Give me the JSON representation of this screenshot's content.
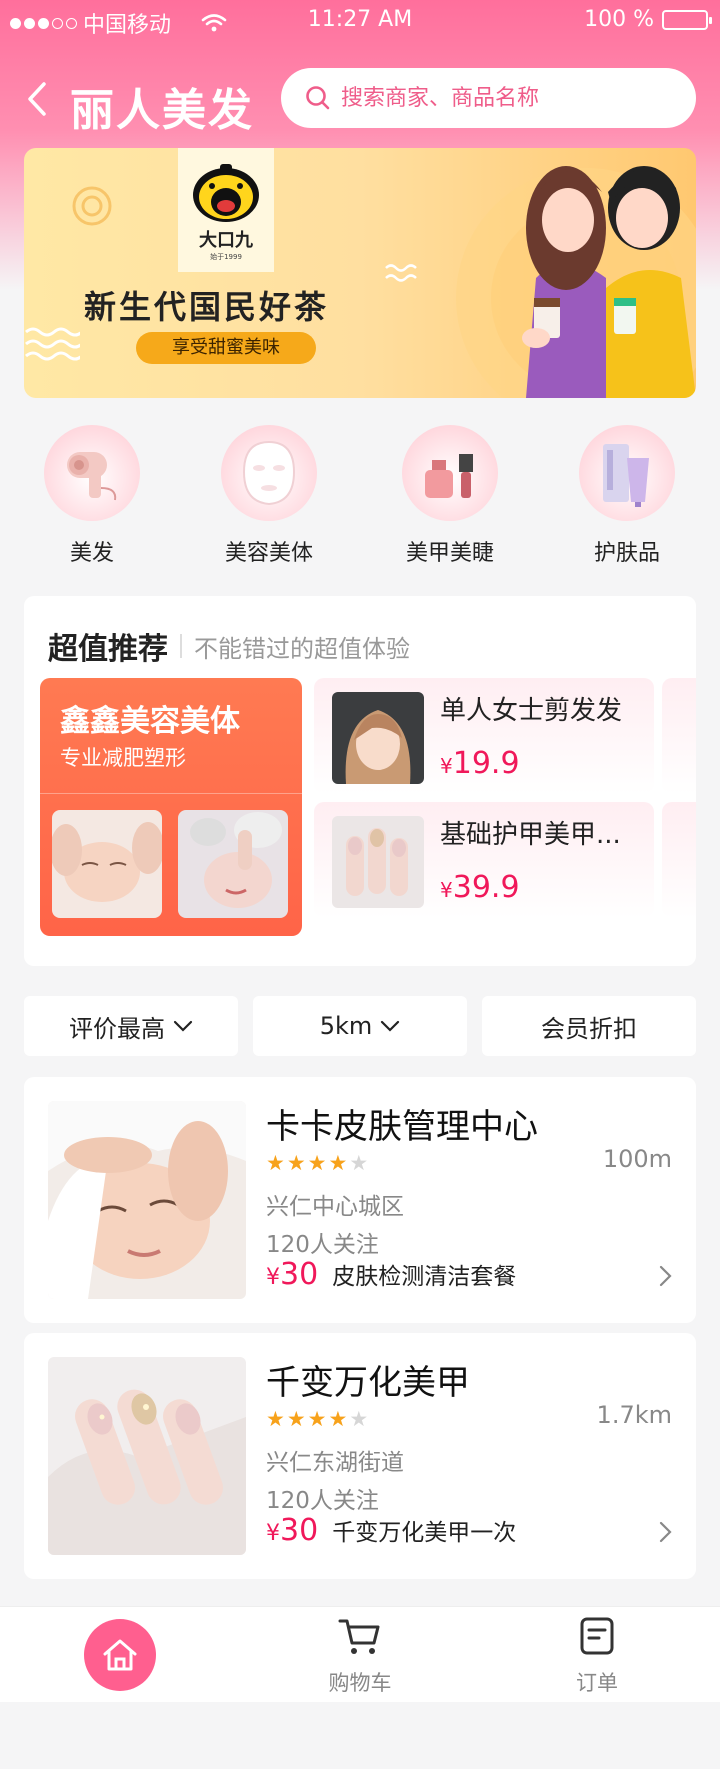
{
  "status_bar": {
    "carrier": "中国移动",
    "time": "11:27 AM",
    "battery": "100 %"
  },
  "header": {
    "title": "丽人美发",
    "search_placeholder": "搜索商家、商品名称"
  },
  "banner": {
    "brand": "大口九",
    "since": "始于1999",
    "headline": "新生代国民好茶",
    "pill": "享受甜蜜美味"
  },
  "categories": [
    {
      "label": "美发",
      "icon": "hair-dryer-icon"
    },
    {
      "label": "美容美体",
      "icon": "face-mask-icon"
    },
    {
      "label": "美甲美睫",
      "icon": "nail-polish-icon"
    },
    {
      "label": "护肤品",
      "icon": "skincare-tube-icon"
    }
  ],
  "recommend": {
    "title": "超值推荐",
    "subtitle": "不能错过的超值体验",
    "promo": {
      "title": "鑫鑫美容美体",
      "subtitle": "专业减肥塑形"
    },
    "deals": [
      {
        "name": "单人女士剪发发",
        "currency": "¥",
        "price": "19.9"
      },
      {
        "name": "基础护甲美甲...",
        "currency": "¥",
        "price": "39.9"
      }
    ]
  },
  "filters": [
    {
      "label": "评价最高",
      "has_chevron": true
    },
    {
      "label": "5km",
      "has_chevron": true
    },
    {
      "label": "会员折扣",
      "has_chevron": false
    }
  ],
  "shops": [
    {
      "name": "卡卡皮肤管理中心",
      "rating": 4,
      "max_rating": 5,
      "distance": "100m",
      "area": "兴仁中心城区",
      "followers": "120人关注",
      "currency": "¥",
      "price": "30",
      "package": "皮肤检测清洁套餐"
    },
    {
      "name": "千变万化美甲",
      "rating": 4,
      "max_rating": 5,
      "distance": "1.7km",
      "area": "兴仁东湖街道",
      "followers": "120人关注",
      "currency": "¥",
      "price": "30",
      "package": "千变万化美甲一次"
    }
  ],
  "tabbar": [
    {
      "label": "",
      "icon": "home-icon",
      "active": true
    },
    {
      "label": "购物车",
      "icon": "cart-icon",
      "active": false
    },
    {
      "label": "订单",
      "icon": "order-icon",
      "active": false
    }
  ],
  "colors": {
    "accent": "#ff5f8f",
    "price": "#f0185a",
    "promo": "#ff6a4a",
    "star": "#f7a21b"
  }
}
